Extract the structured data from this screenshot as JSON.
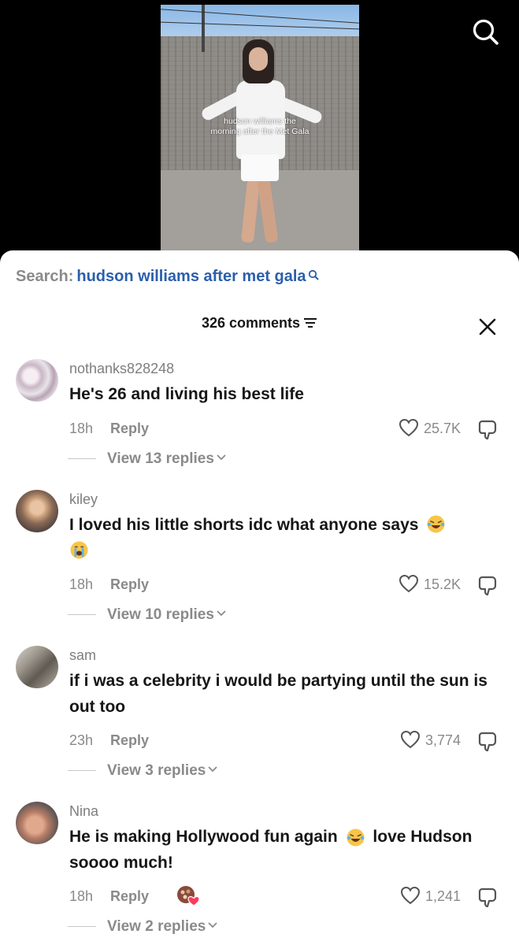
{
  "video": {
    "caption_line1": "hudson williams the",
    "caption_line2": "morning after the Met Gala"
  },
  "search": {
    "prefix": "Search:",
    "query": "hudson williams after met gala"
  },
  "comments_header": {
    "count_label": "326 comments"
  },
  "comments": [
    {
      "username": "nothanks828248",
      "text": "He's 26 and living his best life",
      "time": "18h",
      "reply_label": "Reply",
      "likes": "25.7K",
      "replies_label": "View 13 replies"
    },
    {
      "username": "kiley",
      "text": "I loved his little shorts idc what anyone says",
      "emojis": [
        "laughing-tears-emoji",
        "crying-emoji"
      ],
      "time": "18h",
      "reply_label": "Reply",
      "likes": "15.2K",
      "replies_label": "View 10 replies"
    },
    {
      "username": "sam",
      "text": "if i was a celebrity i would be partying until the sun is out too",
      "time": "23h",
      "reply_label": "Reply",
      "likes": "3,774",
      "replies_label": "View 3 replies"
    },
    {
      "username": "Nina",
      "text_part1": "He is making Hollywood fun again",
      "text_part2": "love Hudson soooo much!",
      "emojis": [
        "laughing-tears-emoji"
      ],
      "time": "18h",
      "reply_label": "Reply",
      "likes": "1,241",
      "replies_label": "View 2 replies",
      "creator_liked": true
    }
  ],
  "colors": {
    "search_query": "#2a5fac",
    "muted_text": "#8a8a8a",
    "primary_text": "#161616",
    "background_top": "#000000",
    "sheet_background": "#ffffff"
  },
  "icons": [
    "search-icon",
    "close-icon",
    "filter-icon",
    "heart-icon",
    "dislike-icon",
    "chevron-down-icon"
  ]
}
